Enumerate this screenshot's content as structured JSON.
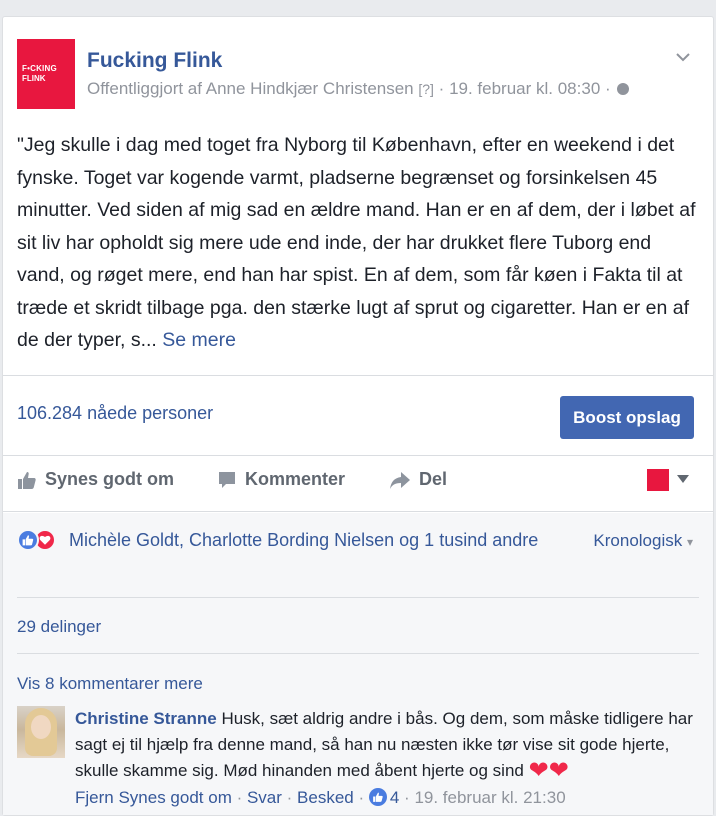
{
  "post": {
    "page_name": "Fucking Flink",
    "logo_line1": "F•CKING",
    "logo_line2": "FLINK",
    "meta_published": "Offentliggjort af Anne Hindkjær Christensen",
    "meta_q": "[?]",
    "meta_sep": " · ",
    "meta_time": "19. februar kl. 08:30",
    "meta_sep2": " · ",
    "text": "\"Jeg skulle i dag med toget fra Nyborg til København, efter en weekend i det fynske. Toget var kogende varmt, pladserne begrænset og forsinkelsen 45 minutter. Ved siden af mig sad en ældre mand. Han er en af dem, der i løbet af sit liv har opholdt sig mere ude end inde, der har drukket flere Tuborg end vand, og røget mere, end han har spist. En af dem, som får køen i Fakta til at træde et skridt tilbage pga. den stærke lugt af sprut og cigaretter. Han er en af de der typer, s...",
    "see_more": "Se mere"
  },
  "insights": {
    "reach": "106.284 nåede personer",
    "boost_label": "Boost opslag"
  },
  "actions": {
    "like": "Synes godt om",
    "comment": "Kommenter",
    "share": "Del"
  },
  "engagement": {
    "reactions_text": "Michèle Goldt, Charlotte Bording Nielsen og 1 tusind andre",
    "sort_label": "Kronologisk",
    "sort_caret": "▾",
    "shares": "29 delinger",
    "more_comments": "Vis 8 kommentarer mere"
  },
  "comment": {
    "author": "Christine Stranne",
    "text": "Husk, sæt aldrig andre i bås. Og dem, som måske tidligere har sagt ej til hjælp fra denne mand, så han nu næsten ikke tør vise sit gode hjerte, skulle skamme sig. Mød hinanden med åbent hjerte og sind",
    "hearts": "❤❤",
    "unlike": "Fjern Synes godt om",
    "reply": "Svar",
    "message": "Besked",
    "like_count": "4",
    "time": "19. februar kl. 21:30",
    "sep": " · "
  },
  "colors": {
    "brand_red": "#e8173f",
    "link_blue": "#365899",
    "button_blue": "#4267b2"
  }
}
